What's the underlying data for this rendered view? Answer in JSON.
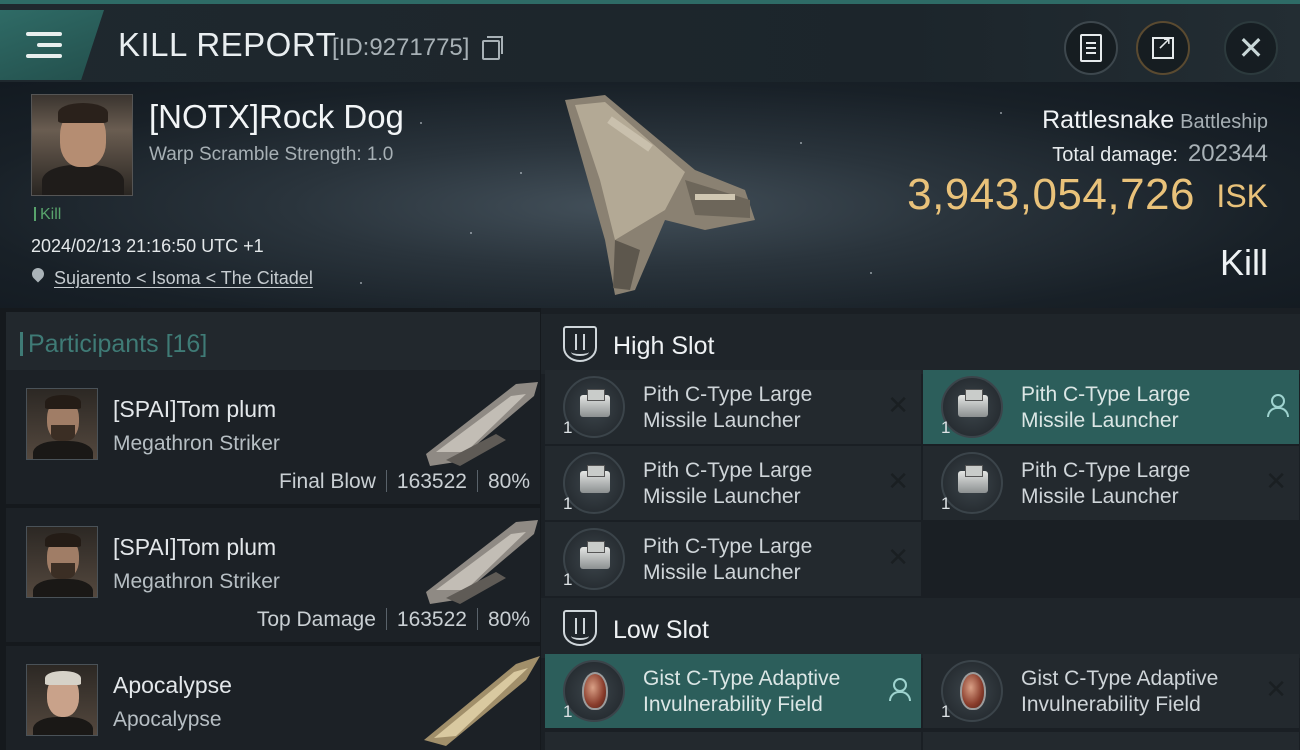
{
  "header": {
    "title": "KILL REPORT",
    "report_id": "[ID:9271775]"
  },
  "victim": {
    "name": "[NOTX]Rock Dog",
    "warp_scramble": "Warp Scramble Strength: 1.0",
    "tag": "Kill",
    "timestamp": "2024/02/13 21:16:50 UTC +1",
    "location": "Sujarento < Isoma < The Citadel",
    "ship": "Rattlesnake",
    "ship_class": "Battleship",
    "total_damage_label": "Total damage:",
    "total_damage": "202344",
    "isk_value": "3,943,054,726",
    "isk_unit": "ISK",
    "outcome": "Kill"
  },
  "participants": {
    "label": "Participants",
    "count": "[16]",
    "rows": [
      {
        "name": "[SPAI]Tom plum",
        "ship": "Megathron Striker",
        "role": "Final Blow",
        "damage": "163522",
        "percent": "80%"
      },
      {
        "name": "[SPAI]Tom plum",
        "ship": "Megathron Striker",
        "role": "Top Damage",
        "damage": "163522",
        "percent": "80%"
      },
      {
        "name": "Apocalypse",
        "ship": "Apocalypse"
      }
    ]
  },
  "fittings": {
    "high_slot_label": "High Slot",
    "low_slot_label": "Low Slot",
    "high": [
      {
        "name_l1": "Pith C-Type Large",
        "name_l2": "Missile Launcher",
        "qty": "1"
      },
      {
        "name_l1": "Pith C-Type Large",
        "name_l2": "Missile Launcher",
        "qty": "1"
      },
      {
        "name_l1": "Pith C-Type Large",
        "name_l2": "Missile Launcher",
        "qty": "1"
      },
      {
        "name_l1": "Pith C-Type Large",
        "name_l2": "Missile Launcher",
        "qty": "1"
      },
      {
        "name_l1": "Pith C-Type Large",
        "name_l2": "Missile Launcher",
        "qty": "1"
      }
    ],
    "low": [
      {
        "name_l1": "Gist C-Type Adaptive",
        "name_l2": "Invulnerability Field",
        "qty": "1"
      },
      {
        "name_l1": "Gist C-Type Adaptive",
        "name_l2": "Invulnerability Field",
        "qty": "1"
      }
    ]
  },
  "colors": {
    "accent": "#2f6b66",
    "isk": "#e9c27a",
    "kill_tag": "#58a36c",
    "active_module": "#2c5e5b"
  }
}
